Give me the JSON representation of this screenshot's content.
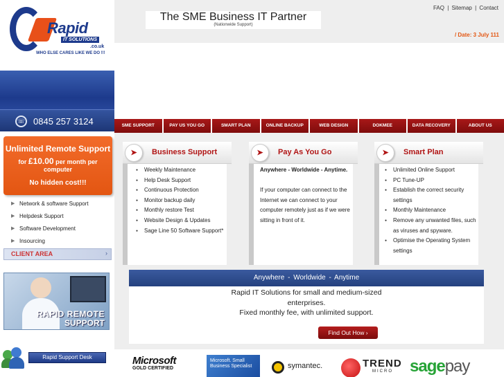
{
  "brand": {
    "logo_name": "Rapid",
    "logo_sub": "IT SOLUTIONS",
    "logo_domain": ".co.uk",
    "tagline": "WHO ELSE CARES LIKE WE DO !!!"
  },
  "header": {
    "title": "The SME Business IT Partner",
    "subtitle": "(Nationwide Support)",
    "links": [
      "FAQ",
      "|",
      "Sitemap",
      "|",
      "Contact"
    ],
    "date": "/ Date: 3 July 111"
  },
  "phone": "0845 257 3124",
  "promo": {
    "title": "Unlimited Remote Support",
    "price_prefix": "for",
    "price": "£10.00",
    "price_suffix": "per month per computer",
    "note": "No hidden cost!!!"
  },
  "side_menu": [
    "Network & software Support",
    "Helpdesk Support",
    "Software Development",
    "Insourcing"
  ],
  "client_area": {
    "label": "CLIENT AREA",
    "arrow": "›"
  },
  "remote_banner": {
    "line1": "RAPID REMOTE",
    "line2": "SUPPORT"
  },
  "desk_button": "Rapid Support Desk",
  "nav": [
    "SME SUPPORT",
    "PAY US YOU GO",
    "SMART PLAN",
    "ONLINE BACKUP",
    "WEB DESIGN",
    "DOKMEE",
    "DATA RECOVERY",
    "ABOUT US"
  ],
  "cards": {
    "business": {
      "title": "Business Support",
      "items": [
        "Weekly Maintenance",
        "Help Desk Support",
        "Continuous Protection",
        "Monitor backup daily",
        "Monthly restore Test",
        "Website Design & Updates",
        "Sage Line 50 Software Support*"
      ]
    },
    "payg": {
      "title": "Pay As You Go",
      "lead": "Anywhere - Worldwide - Anytime.",
      "body": "If your computer can connect to the Internet we can connect to your computer remotely just as if we were sitting in front of it."
    },
    "smart": {
      "title": "Smart Plan",
      "items": [
        "Unlimited Online Support",
        "PC Tune-UP",
        "Establish the correct security settings",
        "Monthly Maintenance",
        "Remove any unwanted files, such as viruses and spyware.",
        "Optimise the Operating System settings"
      ]
    }
  },
  "slogan": {
    "bar": "Anywhere  -  Worldwide  -  Anytime",
    "line1": "Rapid IT Solutions for small and medium-sized",
    "line2": "enterprises.",
    "line3": "Fixed monthly fee, with unlimited support.",
    "cta": "Find Out How ›"
  },
  "partners": {
    "microsoft": "Microsoft",
    "ms_cert": "GOLD CERTIFIED",
    "msb": "Microsoft. Small Business Specialist",
    "symantec": "symantec.",
    "trend": "TREND",
    "trend_sub": "MICRO",
    "sage": "sage",
    "sage_pay": "pay"
  },
  "colors": {
    "brand_blue": "#1d3a8c",
    "accent_orange": "#e35612",
    "nav_red": "#a81818"
  }
}
